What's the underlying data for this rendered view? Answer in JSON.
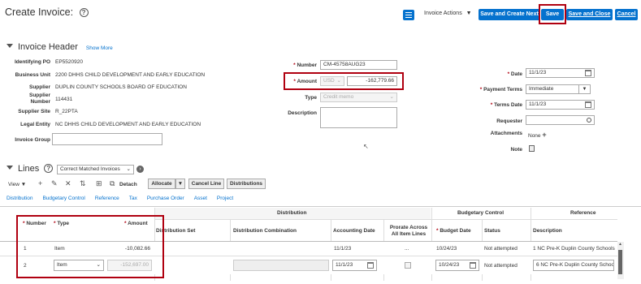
{
  "page": {
    "title": "Create Invoice:",
    "help_icon": "?",
    "invoice_actions_label": "Invoice Actions",
    "buttons": {
      "save_and_create_next": "Save and Create Next",
      "save": "Save",
      "save_and_close": "Save and Close",
      "cancel": "Cancel"
    }
  },
  "header": {
    "title": "Invoice Header",
    "show_more": "Show More",
    "fields_left": [
      {
        "label": "Identifying PO",
        "value": "EP5520920"
      },
      {
        "label": "Business Unit",
        "value": "2200 DHHS CHILD DEVELOPMENT AND EARLY EDUCATION"
      },
      {
        "label": "Supplier",
        "value": "DUPLIN COUNTY SCHOOLS BOARD OF EDUCATION"
      },
      {
        "label": "Supplier Number",
        "value": "114431"
      },
      {
        "label": "Supplier Site",
        "value": "R_22PTA"
      },
      {
        "label": "Legal Entity",
        "value": "NC DHHS CHILD DEVELOPMENT AND EARLY EDUCATION"
      },
      {
        "label": "Invoice Group",
        "value": ""
      }
    ],
    "supplier_number_label_line1": "Supplier",
    "supplier_number_label_line2": "Number",
    "number_label": "Number",
    "number_value": "CM-45758AUG23",
    "amount_label": "Amount",
    "amount_currency": "USD",
    "amount_value": "-162,779.66",
    "type_label": "Type",
    "type_value": "Credit memo",
    "description_label": "Description",
    "description_value": "",
    "date_label": "Date",
    "date_value": "11/1/23",
    "payment_terms_label": "Payment Terms",
    "payment_terms_value": "Immediate",
    "terms_date_label": "Terms Date",
    "terms_date_value": "11/1/23",
    "requester_label": "Requester",
    "requester_value": "",
    "attachments_label": "Attachments",
    "attachments_value": "None",
    "note_label": "Note"
  },
  "lines": {
    "title": "Lines",
    "match_select": "Correct Matched Invoices",
    "view_label": "View",
    "detach_label": "Detach",
    "allocate_label": "Allocate",
    "cancel_line_label": "Cancel Line",
    "distributions_label": "Distributions",
    "tabs": [
      "Distribution",
      "Budgetary Control",
      "Reference",
      "Tax",
      "Purchase Order",
      "Asset",
      "Project"
    ],
    "group_headers": {
      "distribution": "Distribution",
      "budgetary_control": "Budgetary Control",
      "reference": "Reference"
    },
    "columns": {
      "number": "Number",
      "type": "Type",
      "amount": "Amount",
      "distribution_set": "Distribution Set",
      "distribution_combination": "Distribution Combination",
      "accounting_date": "Accounting Date",
      "prorate_line1": "Prorate Across",
      "prorate_line2": "All Item Lines",
      "budget_date": "Budget Date",
      "status": "Status",
      "description": "Description"
    },
    "rows": [
      {
        "number": "1",
        "type": "Item",
        "amount": "-10,082.66",
        "accounting_date": "11/1/23",
        "prorate": "...",
        "budget_date": "10/24/23",
        "status": "Not attempted",
        "description": "1 NC Pre-K Duplin County Schools"
      },
      {
        "number": "2",
        "type": "Item",
        "amount": "-152,697.00",
        "accounting_date": "11/1/23",
        "prorate": "",
        "budget_date": "10/24/23",
        "status": "Not attempted",
        "description": "6 NC Pre-K Duplin County Schoo"
      }
    ]
  }
}
